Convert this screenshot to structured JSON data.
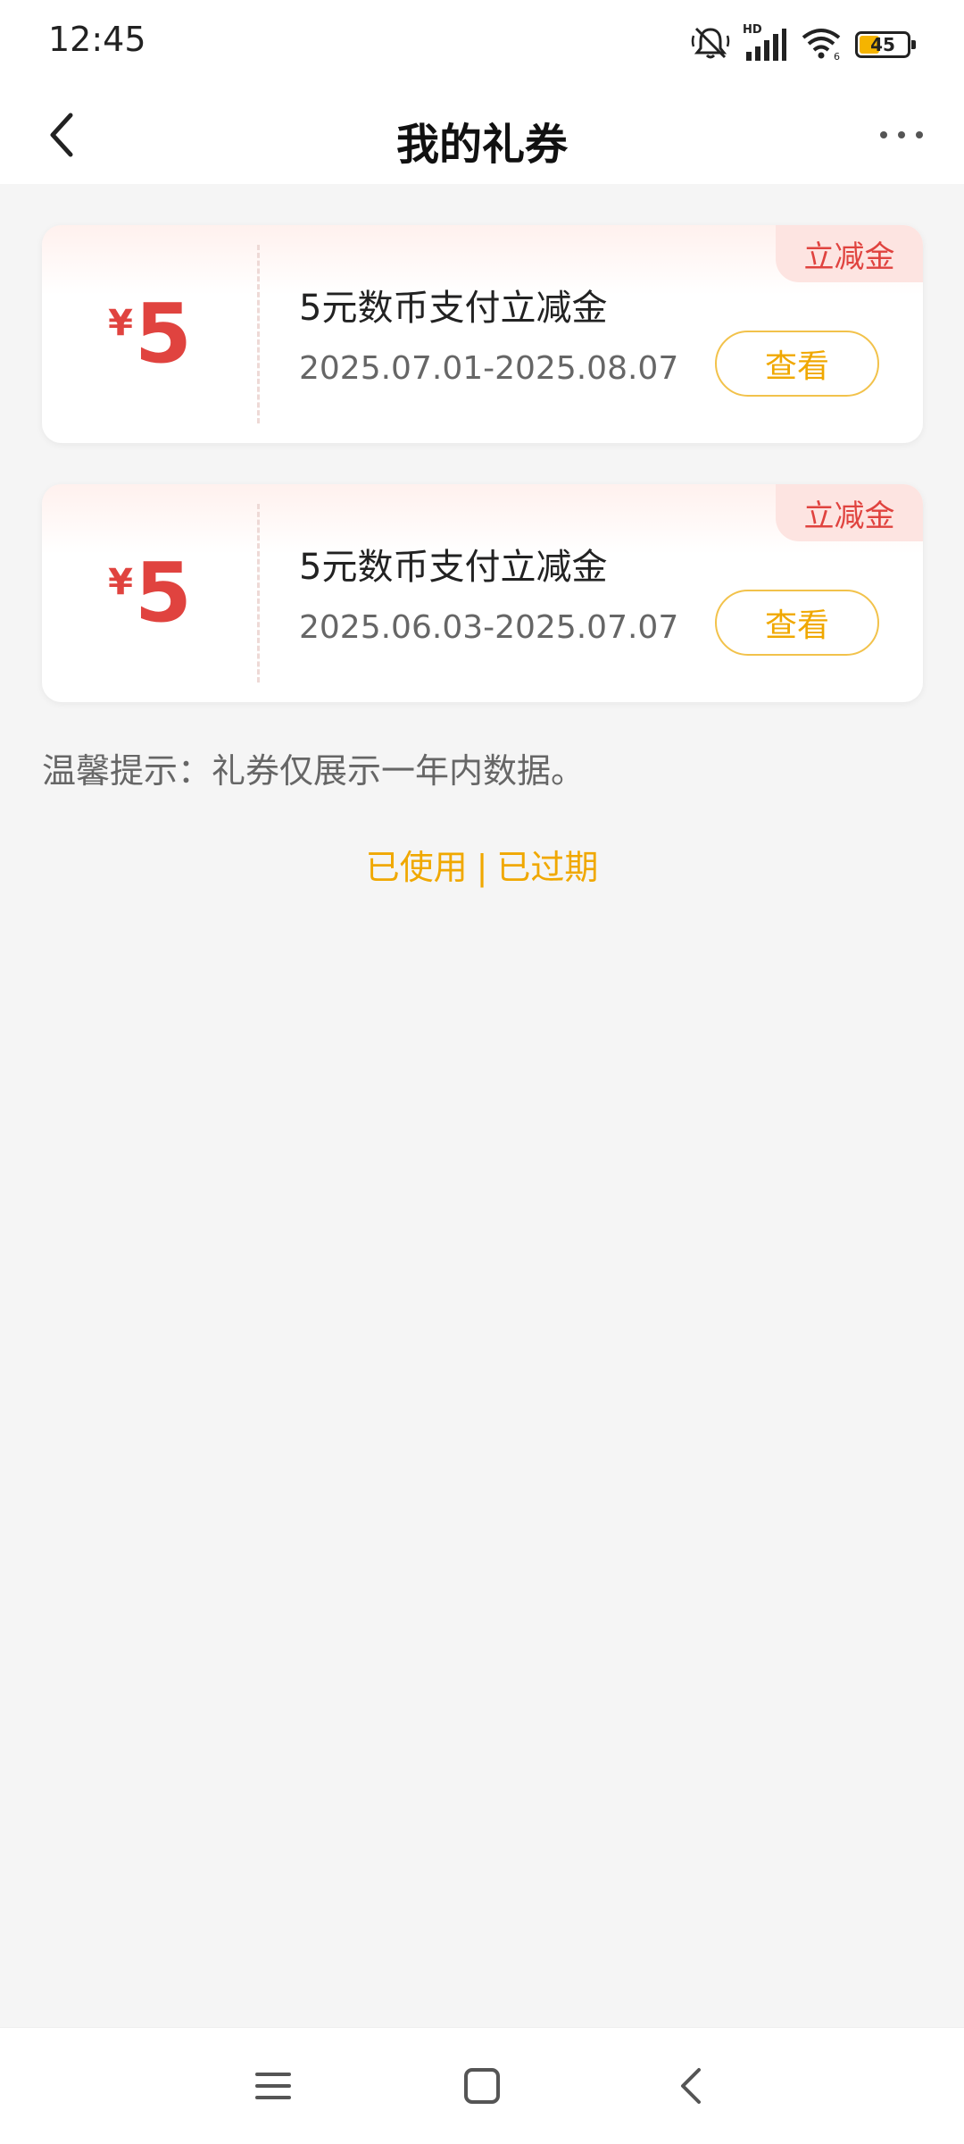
{
  "status_bar": {
    "time": "12:45",
    "network_label": "HD",
    "battery_level": "45",
    "icons": [
      "mute-icon",
      "signal-icon",
      "wifi-icon",
      "battery-icon"
    ]
  },
  "header": {
    "title": "我的礼券",
    "back_icon": "chevron-left-icon",
    "more_icon": "more-dots-icon"
  },
  "coupons": [
    {
      "tag": "立减金",
      "currency": "¥",
      "amount": "5",
      "title": "5元数币支付立减金",
      "date_range": "2025.07.01-2025.08.07",
      "button_label": "查看"
    },
    {
      "tag": "立减金",
      "currency": "¥",
      "amount": "5",
      "title": "5元数币支付立减金",
      "date_range": "2025.06.03-2025.07.07",
      "button_label": "查看"
    }
  ],
  "tip": "温馨提示：礼券仅展示一年内数据。",
  "links": {
    "used": "已使用",
    "separator": "|",
    "expired": "已过期"
  },
  "system_nav": [
    "menu-icon",
    "home-icon",
    "back-icon"
  ],
  "colors": {
    "accent_red": "#e0433f",
    "accent_orange": "#f0a800",
    "background": "#f5f5f5"
  }
}
